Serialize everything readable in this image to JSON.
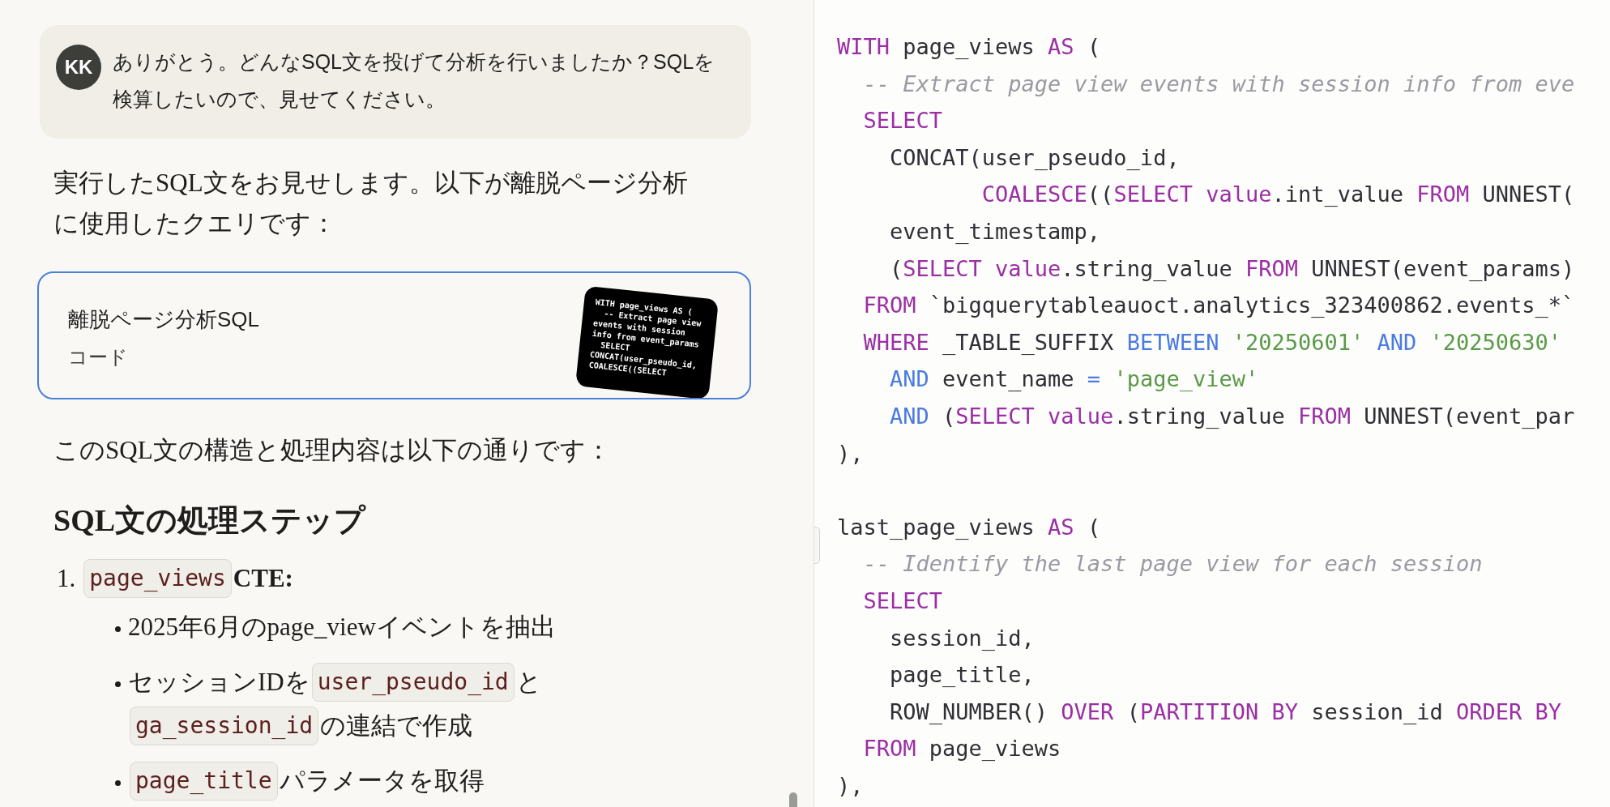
{
  "user_message": {
    "avatar": "KK",
    "text": "ありがとう。どんなSQL文を投げて分析を行いましたか？SQLを検算したいので、見せてください。"
  },
  "response": {
    "intro": "実行したSQL文をお見せします。以下が離脱ページ分析に使用したクエリです：",
    "artifact": {
      "title": "離脱ページ分析SQL",
      "type": "コード",
      "preview_lines": [
        "WITH page_views AS (",
        "  -- Extract page view",
        "events with session",
        "info from event_params",
        "  SELECT",
        "CONCAT(user_pseudo_id,",
        "COALESCE((SELECT"
      ]
    },
    "paragraph": "このSQL文の構造と処理内容は以下の通りです：",
    "heading": "SQL文の処理ステップ",
    "steps": [
      {
        "number": "1.",
        "parts": [
          {
            "kind": "code",
            "text": "page_views"
          },
          {
            "kind": "bold",
            "text": "CTE:"
          }
        ],
        "bullets": [
          [
            [
              {
                "kind": "text",
                "text": "2025年6月のpage_viewイベントを抽出"
              }
            ]
          ],
          [
            [
              {
                "kind": "text",
                "text": "セッションIDを"
              },
              {
                "kind": "code",
                "text": "user_pseudo_id"
              },
              {
                "kind": "text",
                "text": "と"
              }
            ],
            [
              {
                "kind": "code",
                "text": "ga_session_id"
              },
              {
                "kind": "text",
                "text": "の連結で作成"
              }
            ]
          ],
          [
            [
              {
                "kind": "code",
                "text": "page_title"
              },
              {
                "kind": "text",
                "text": "パラメータを取得"
              }
            ]
          ]
        ]
      }
    ]
  },
  "code_panel": {
    "lines": [
      [
        {
          "kind": "kw",
          "text": "WITH "
        },
        {
          "kind": "plain",
          "text": "page_views "
        },
        {
          "kind": "kw",
          "text": "AS "
        },
        {
          "kind": "plain",
          "text": "("
        }
      ],
      [
        {
          "kind": "comment",
          "text": "  -- Extract page view events with session info from eve"
        }
      ],
      [
        {
          "kind": "kw",
          "text": "  SELECT"
        }
      ],
      [
        {
          "kind": "plain",
          "text": "    CONCAT(user_pseudo_id,"
        }
      ],
      [
        {
          "kind": "kw",
          "text": "           COALESCE"
        },
        {
          "kind": "plain",
          "text": "(("
        },
        {
          "kind": "kw",
          "text": "SELECT value"
        },
        {
          "kind": "plain",
          "text": ".int_value "
        },
        {
          "kind": "kw",
          "text": "FROM "
        },
        {
          "kind": "plain",
          "text": "UNNEST("
        }
      ],
      [
        {
          "kind": "plain",
          "text": "    event_timestamp,"
        }
      ],
      [
        {
          "kind": "plain",
          "text": "    ("
        },
        {
          "kind": "kw",
          "text": "SELECT value"
        },
        {
          "kind": "plain",
          "text": ".string_value "
        },
        {
          "kind": "kw",
          "text": "FROM "
        },
        {
          "kind": "plain",
          "text": "UNNEST(event_params)"
        }
      ],
      [
        {
          "kind": "kw",
          "text": "  FROM "
        },
        {
          "kind": "plain",
          "text": "`bigquerytableauoct.analytics_323400862.events_*`"
        }
      ],
      [
        {
          "kind": "kw",
          "text": "  WHERE "
        },
        {
          "kind": "plain",
          "text": "_TABLE_SUFFIX "
        },
        {
          "kind": "op",
          "text": "BETWEEN "
        },
        {
          "kind": "str",
          "text": "'20250601' "
        },
        {
          "kind": "op",
          "text": "AND "
        },
        {
          "kind": "str",
          "text": "'20250630'"
        }
      ],
      [
        {
          "kind": "op",
          "text": "    AND "
        },
        {
          "kind": "plain",
          "text": "event_name "
        },
        {
          "kind": "op",
          "text": "= "
        },
        {
          "kind": "str",
          "text": "'page_view'"
        }
      ],
      [
        {
          "kind": "op",
          "text": "    AND "
        },
        {
          "kind": "plain",
          "text": "("
        },
        {
          "kind": "kw",
          "text": "SELECT value"
        },
        {
          "kind": "plain",
          "text": ".string_value "
        },
        {
          "kind": "kw",
          "text": "FROM "
        },
        {
          "kind": "plain",
          "text": "UNNEST(event_par"
        }
      ],
      [
        {
          "kind": "plain",
          "text": "),"
        }
      ],
      {
        "gap_before": true,
        "tokens": [
          {
            "kind": "plain",
            "text": "last_page_views "
          },
          {
            "kind": "kw",
            "text": "AS "
          },
          {
            "kind": "plain",
            "text": "("
          }
        ]
      },
      [
        {
          "kind": "comment",
          "text": "  -- Identify the last page view for each session"
        }
      ],
      [
        {
          "kind": "kw",
          "text": "  SELECT"
        }
      ],
      [
        {
          "kind": "plain",
          "text": "    session_id,"
        }
      ],
      [
        {
          "kind": "plain",
          "text": "    page_title,"
        }
      ],
      [
        {
          "kind": "plain",
          "text": "    ROW_NUMBER() "
        },
        {
          "kind": "kw",
          "text": "OVER "
        },
        {
          "kind": "plain",
          "text": "("
        },
        {
          "kind": "kw",
          "text": "PARTITION BY "
        },
        {
          "kind": "plain",
          "text": "session_id "
        },
        {
          "kind": "kw",
          "text": "ORDER BY"
        }
      ],
      [
        {
          "kind": "kw",
          "text": "  FROM "
        },
        {
          "kind": "plain",
          "text": "page_views"
        }
      ],
      [
        {
          "kind": "plain",
          "text": "),"
        }
      ]
    ]
  }
}
